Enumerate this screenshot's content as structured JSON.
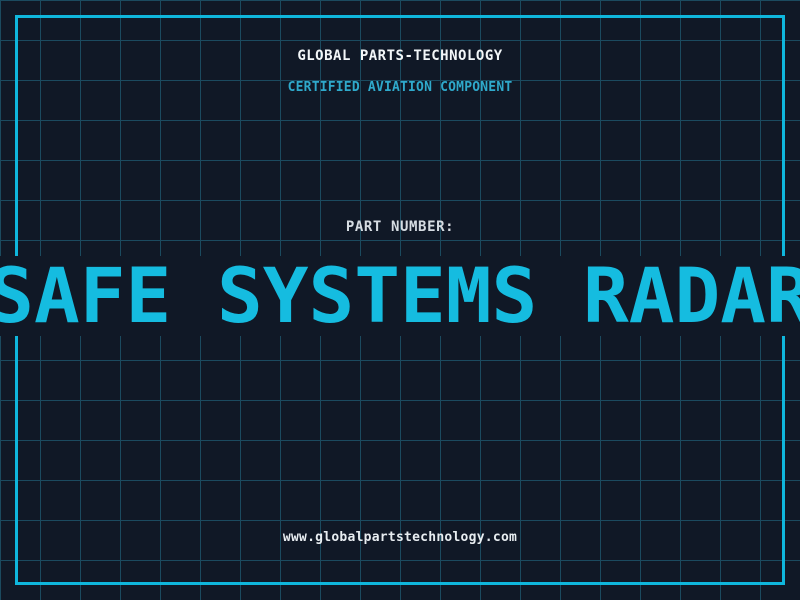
{
  "theme": {
    "bg_color": "#101826",
    "grid_color": "#1b4a5f",
    "accent_color": "#0fb6dc",
    "part_name_color": "#15bce0",
    "tagline_color": "#2fa9cb",
    "title_color": "#f2f6f8",
    "label_color": "#d6dce2",
    "url_color": "#e8edf1"
  },
  "header": {
    "company_name": "GLOBAL PARTS-TECHNOLOGY",
    "tagline": "CERTIFIED AVIATION COMPONENT"
  },
  "part": {
    "label": "PART NUMBER:",
    "name": "SAFE SYSTEMS RADAR"
  },
  "footer": {
    "website": "www.globalpartstechnology.com"
  }
}
